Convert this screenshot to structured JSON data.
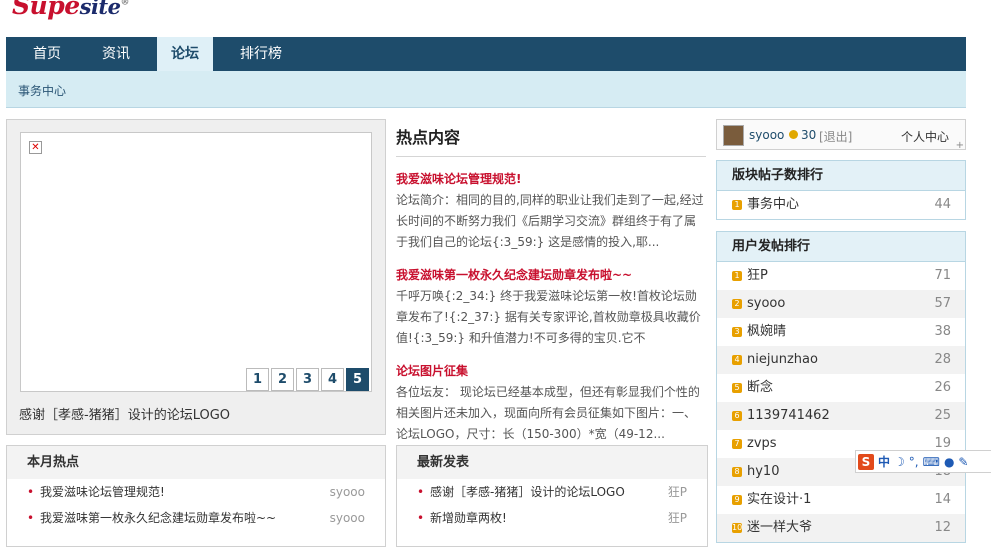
{
  "logo": {
    "text_red": "Supe",
    "text_blue": "site",
    "mark": "®"
  },
  "nav": {
    "items": [
      "首页",
      "资讯",
      "论坛",
      "排行榜"
    ],
    "active_index": 2
  },
  "subnav": {
    "label": "事务中心"
  },
  "slider": {
    "pages": [
      "1",
      "2",
      "3",
      "4",
      "5"
    ],
    "current": 5,
    "caption": "感谢［孝感-猪猪］设计的论坛LOGO",
    "image_icon": "broken-image-icon"
  },
  "hot": {
    "title": "热点内容",
    "items": [
      {
        "title": "我爱滋味论坛管理规范!",
        "summary": "论坛简介：相同的目的,同样的职业让我们走到了一起,经过长时间的不断努力我们《后期学习交流》群组终于有了属于我们自己的论坛{:3_59:} 这是感情的投入,耶..."
      },
      {
        "title": "我爱滋味第一枚永久纪念建坛勋章发布啦~~",
        "summary": "千呼万唤{:2_34:} 终于我爱滋味论坛第一枚!首枚论坛勋章发布了!{:2_37:} 据有关专家评论,首枚勋章极具收藏价值!{:3_59:} 和升值潜力!不可多得的宝贝.它不"
      },
      {
        "title": "论坛图片征集",
        "summary": "各位坛友： 现论坛已经基本成型，但还有彰显我们个性的相关图片还未加入，现面向所有会员征集如下图片：一、论坛LOGO，尺寸：长（150-300）*宽（49-12..."
      }
    ]
  },
  "user": {
    "name": "syooo",
    "coins": "30",
    "logout": "[退出]",
    "center": "个人中心",
    "expand": "+",
    "coin_icon": "coin-icon"
  },
  "board_rank": {
    "title": "版块帖子数排行",
    "rows": [
      {
        "n": "1",
        "name": "事务中心",
        "value": "44"
      }
    ]
  },
  "user_rank": {
    "title": "用户发帖排行",
    "rows": [
      {
        "n": "1",
        "name": "狂P",
        "value": "71"
      },
      {
        "n": "2",
        "name": "syooo",
        "value": "57"
      },
      {
        "n": "3",
        "name": "枫婉晴",
        "value": "38"
      },
      {
        "n": "4",
        "name": "niejunzhao",
        "value": "28"
      },
      {
        "n": "5",
        "name": "断念",
        "value": "26"
      },
      {
        "n": "6",
        "name": "1139741462",
        "value": "25"
      },
      {
        "n": "7",
        "name": "zvps",
        "value": "19"
      },
      {
        "n": "8",
        "name": "hy10",
        "value": "18"
      },
      {
        "n": "9",
        "name": "实在设计·1",
        "value": "14"
      },
      {
        "n": "10",
        "name": "迷一样大爷",
        "value": "12"
      }
    ]
  },
  "month_hot": {
    "title": "本月热点",
    "rows": [
      {
        "title": "我爱滋味论坛管理规范!",
        "author": "syooo"
      },
      {
        "title": "我爱滋味第一枚永久纪念建坛勋章发布啦~~",
        "author": "syooo"
      }
    ]
  },
  "latest": {
    "title": "最新发表",
    "rows": [
      {
        "title": "感谢［孝感-猪猪］设计的论坛LOGO",
        "author": "狂P"
      },
      {
        "title": "新增勋章两枚!",
        "author": "狂P"
      }
    ]
  },
  "ime": {
    "logo": "S",
    "lang": "中",
    "moon": "☽",
    "punct": "°,",
    "keyboard": "⌨",
    "user": "●",
    "tools": "✎"
  },
  "colors": {
    "nav_bg": "#1e4c6b",
    "accent_red": "#c8102e",
    "subnav_bg": "#d6ecf3",
    "rank_badge": "#e8a000"
  }
}
